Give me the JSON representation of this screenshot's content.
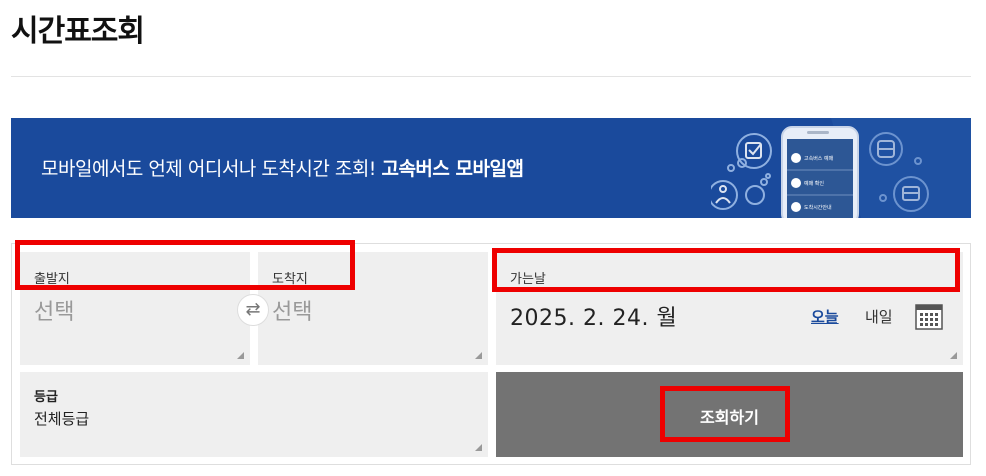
{
  "page": {
    "title": "시간표조회"
  },
  "banner": {
    "text": "모바일에서도 언제 어디서나 도착시간 조회!",
    "text_bold": "고속버스 모바일앱",
    "background": "#1a4a9c",
    "phone_menu": [
      "고속버스 예매",
      "예매 확인",
      "도착시간안내"
    ]
  },
  "search": {
    "departure": {
      "label": "출발지",
      "value": "선택"
    },
    "arrival": {
      "label": "도착지",
      "value": "선택"
    },
    "swap_icon": "swap-arrows-icon",
    "date": {
      "label": "가는날",
      "value": "2025. 2. 24. 월",
      "today_label": "오늘",
      "tomorrow_label": "내일",
      "calendar_icon": "calendar-icon"
    },
    "grade": {
      "label": "등급",
      "value": "전체등급"
    },
    "submit_label": "조회하기"
  },
  "colors": {
    "accent": "#1a4a9c",
    "search_button": "#737373",
    "highlight": "#ee0000"
  }
}
